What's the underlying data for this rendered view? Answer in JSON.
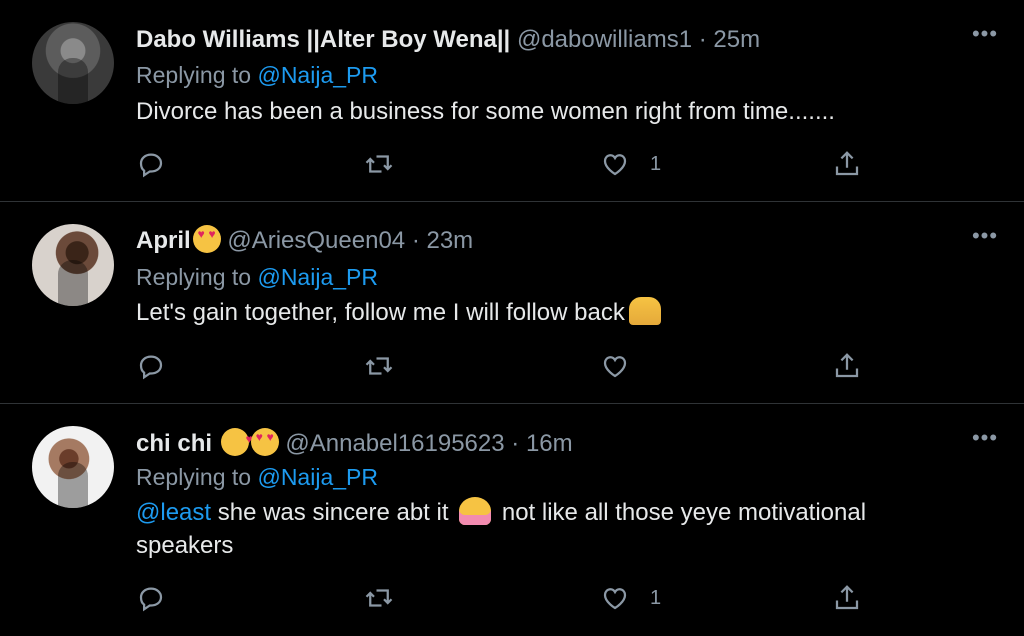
{
  "tweets": [
    {
      "name": "Dabo Williams ||Alter Boy Wena||",
      "handle": "@dabowilliams1",
      "separator": "·",
      "time": "25m",
      "replying_label": "Replying to",
      "replying_to": "@Naija_PR",
      "text": "Divorce has been a business for some women right from time.......",
      "like_count": "1"
    },
    {
      "name": "April",
      "handle": "@AriesQueen04",
      "separator": "·",
      "time": "23m",
      "replying_label": "Replying to",
      "replying_to": "@Naija_PR",
      "text": "Let's gain together, follow me I will follow back",
      "like_count": ""
    },
    {
      "name": "chi chi",
      "handle": "@Annabel16195623",
      "separator": "·",
      "time": "16m",
      "replying_label": "Replying to",
      "replying_to": "@Naija_PR",
      "text_mention": "@least",
      "text_a": "she was sincere abt it",
      "text_b": "not like all those yeye motivational speakers",
      "like_count": "1"
    }
  ],
  "more_label": "•••",
  "colors": {
    "background": "#000000",
    "link": "#1d9bf0",
    "secondary_text": "#8b98a5",
    "divider": "#2f3336"
  },
  "icons": [
    "reply-icon",
    "retweet-icon",
    "like-icon",
    "share-icon",
    "more-icon"
  ]
}
